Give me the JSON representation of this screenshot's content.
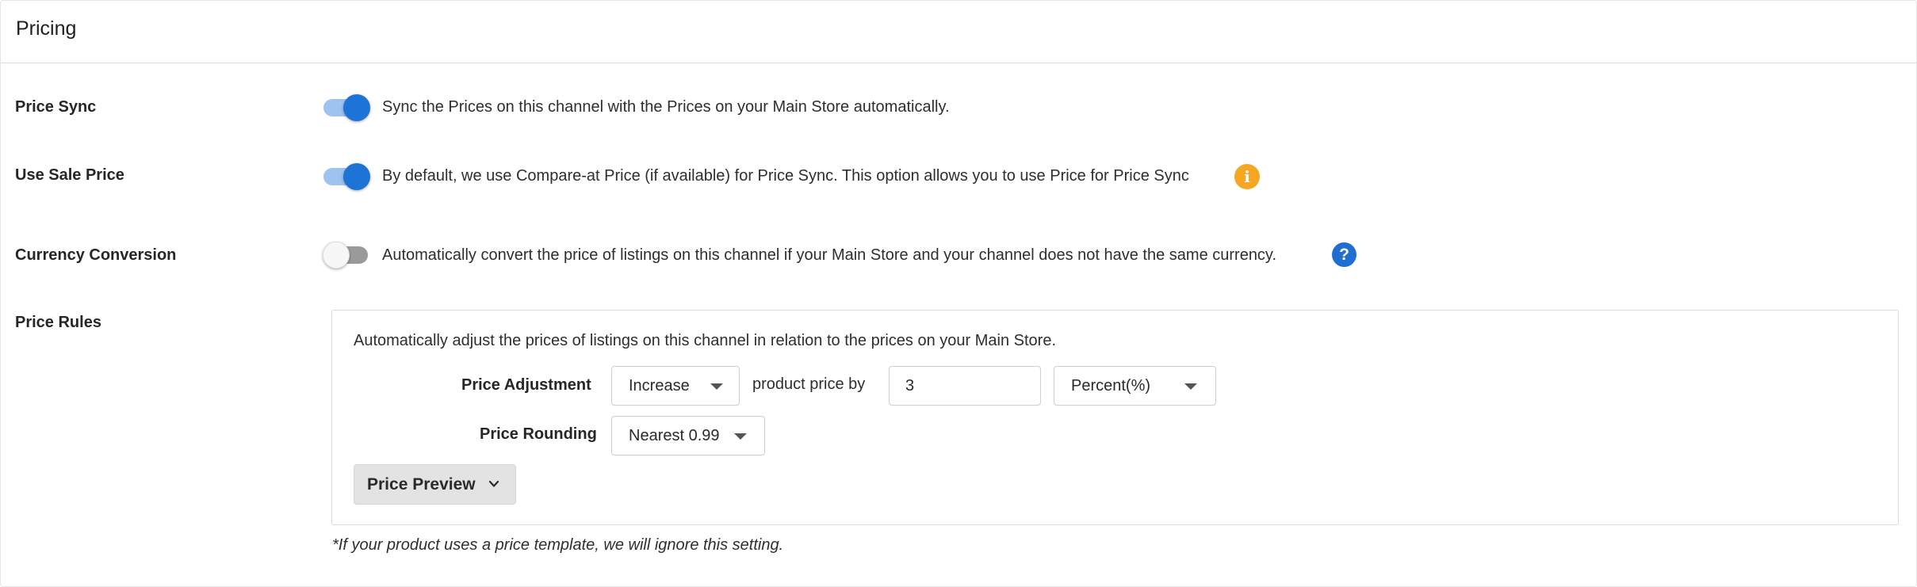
{
  "panel": {
    "title": "Pricing"
  },
  "price_sync": {
    "label": "Price Sync",
    "enabled": true,
    "description": "Sync the Prices on this channel with the Prices on your Main Store automatically."
  },
  "use_sale_price": {
    "label": "Use Sale Price",
    "enabled": true,
    "description": "By default, we use Compare-at Price (if available) for Price Sync. This option allows you to use Price for Price Sync",
    "info_icon": "info-icon",
    "info_glyph": "i"
  },
  "currency_conversion": {
    "label": "Currency Conversion",
    "enabled": false,
    "description": "Automatically convert the price of listings on this channel if your Main Store and your channel does not have the same currency.",
    "help_icon": "help-icon",
    "help_glyph": "?"
  },
  "price_rules": {
    "label": "Price Rules",
    "description": "Automatically adjust the prices of listings on this channel in relation to the prices on your Main Store.",
    "adjustment": {
      "label": "Price Adjustment",
      "direction": "Increase",
      "connector_text": "product price by",
      "amount": "3",
      "unit": "Percent(%)"
    },
    "rounding": {
      "label": "Price Rounding",
      "value": "Nearest 0.99"
    },
    "preview_button": {
      "label": "Price Preview",
      "icon": "chevron-down-icon"
    },
    "footnote": "*If your product uses a price template, we will ignore this setting."
  },
  "colors": {
    "accent": "#1e73d6",
    "toggle_track_on": "#9ec3f1",
    "warning_icon": "#f5a623",
    "help_icon": "#1e6fd0"
  }
}
